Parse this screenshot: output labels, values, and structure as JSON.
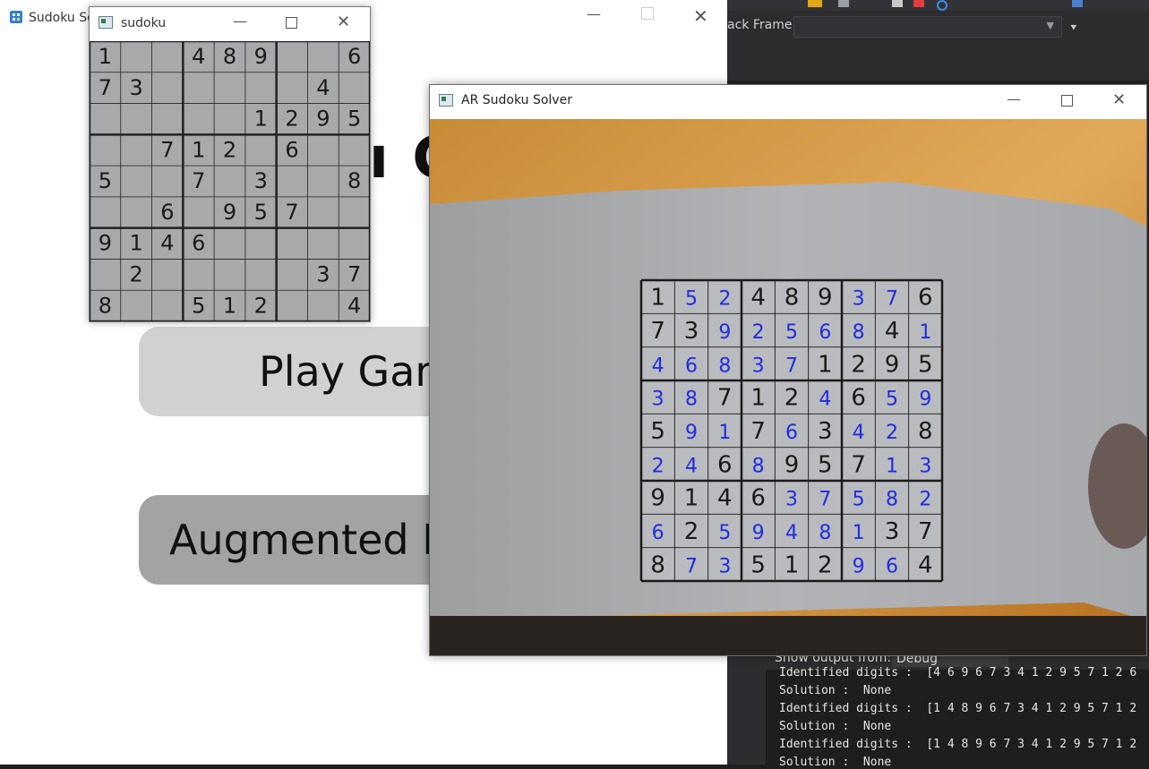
{
  "vs": {
    "stack_frame_label": "ack Frame:",
    "stack_frame_value": "",
    "output_label": "Show output from:",
    "output_source": "Debug",
    "output_lines": [
      "Identified digits :  [4 6 9 6 7 3 4 1 2 9 5 7 1 2 6",
      "Solution :  None",
      "Identified digits :  [1 4 8 9 6 7 3 4 1 2 9 5 7 1 2",
      "Solution :  None",
      "Identified digits :  [1 4 8 9 6 7 3 4 1 2 9 5 7 1 2",
      "Solution :  None"
    ]
  },
  "main_window": {
    "title": "Sudoku Solver",
    "heading_fragment": "ı G",
    "buttons": {
      "play": "Play Game",
      "ar": "Augmented Reality"
    }
  },
  "small_window": {
    "title": "sudoku",
    "grid": [
      [
        "1",
        "",
        "",
        "4",
        "8",
        "9",
        "",
        "",
        "6"
      ],
      [
        "7",
        "3",
        "",
        "",
        "",
        "",
        "",
        "4",
        ""
      ],
      [
        "",
        "",
        "",
        "",
        "",
        "1",
        "2",
        "9",
        "5"
      ],
      [
        "",
        "",
        "7",
        "1",
        "2",
        "",
        "6",
        "",
        ""
      ],
      [
        "5",
        "",
        "",
        "7",
        "",
        "3",
        "",
        "",
        "8"
      ],
      [
        "",
        "",
        "6",
        "",
        "9",
        "5",
        "7",
        "",
        ""
      ],
      [
        "9",
        "1",
        "4",
        "6",
        "",
        "",
        "",
        "",
        ""
      ],
      [
        "",
        "2",
        "",
        "",
        "",
        "",
        "",
        "3",
        "7"
      ],
      [
        "8",
        "",
        "",
        "5",
        "1",
        "2",
        "",
        "",
        "4"
      ]
    ]
  },
  "ar_window": {
    "title": "AR Sudoku Solver",
    "given_color": "#1a1a1a",
    "solved_color": "#1f2ee0",
    "grid": [
      [
        "1",
        "5",
        "2",
        "4",
        "8",
        "9",
        "3",
        "7",
        "6"
      ],
      [
        "7",
        "3",
        "9",
        "2",
        "5",
        "6",
        "8",
        "4",
        "1"
      ],
      [
        "4",
        "6",
        "8",
        "3",
        "7",
        "1",
        "2",
        "9",
        "5"
      ],
      [
        "3",
        "8",
        "7",
        "1",
        "2",
        "4",
        "6",
        "5",
        "9"
      ],
      [
        "5",
        "9",
        "1",
        "7",
        "6",
        "3",
        "4",
        "2",
        "8"
      ],
      [
        "2",
        "4",
        "6",
        "8",
        "9",
        "5",
        "7",
        "1",
        "3"
      ],
      [
        "9",
        "1",
        "4",
        "6",
        "3",
        "7",
        "5",
        "8",
        "2"
      ],
      [
        "6",
        "2",
        "5",
        "9",
        "4",
        "8",
        "1",
        "3",
        "7"
      ],
      [
        "8",
        "7",
        "3",
        "5",
        "1",
        "2",
        "9",
        "6",
        "4"
      ]
    ],
    "given": [
      [
        1,
        0,
        0,
        1,
        1,
        1,
        0,
        0,
        1
      ],
      [
        1,
        1,
        0,
        0,
        0,
        0,
        0,
        1,
        0
      ],
      [
        0,
        0,
        0,
        0,
        0,
        1,
        1,
        1,
        1
      ],
      [
        0,
        0,
        1,
        1,
        1,
        0,
        1,
        0,
        0
      ],
      [
        1,
        0,
        0,
        1,
        0,
        1,
        0,
        0,
        1
      ],
      [
        0,
        0,
        1,
        0,
        1,
        1,
        1,
        0,
        0
      ],
      [
        1,
        1,
        1,
        1,
        0,
        0,
        0,
        0,
        0
      ],
      [
        0,
        1,
        0,
        0,
        0,
        0,
        0,
        1,
        1
      ],
      [
        1,
        0,
        0,
        1,
        1,
        1,
        0,
        0,
        1
      ]
    ]
  },
  "icons": {
    "minimize": "minimize-icon",
    "maximize": "maximize-icon",
    "close": "close-icon",
    "app": "app-icon"
  }
}
